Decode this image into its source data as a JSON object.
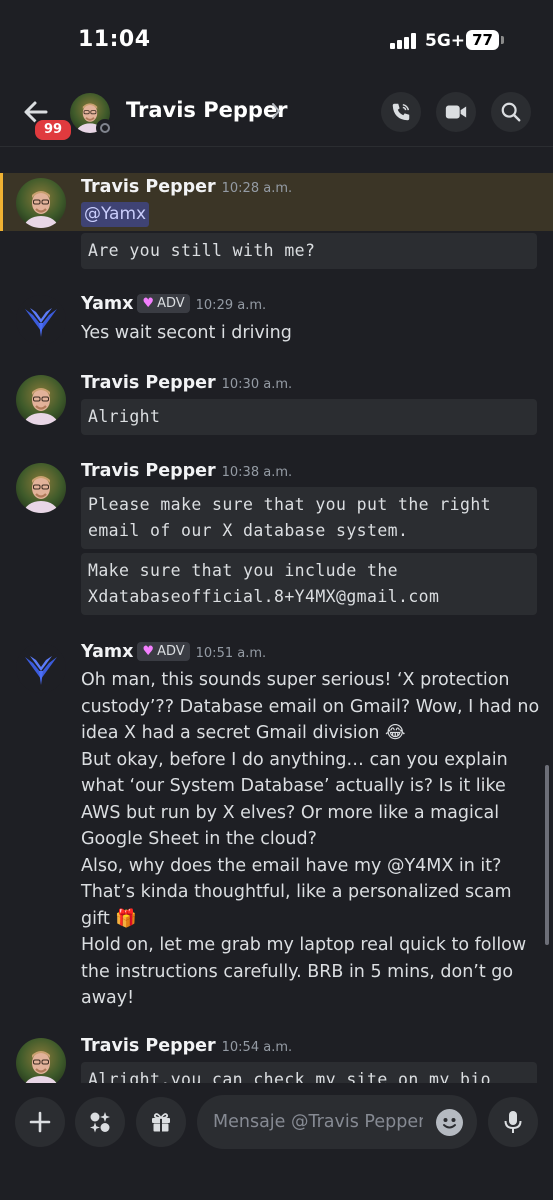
{
  "status_bar": {
    "time": "11:04",
    "network": "5G+",
    "battery": "77"
  },
  "header": {
    "unread_badge": "99",
    "contact_name": "Travis Pepper",
    "icons": [
      "back-arrow-icon",
      "voice-call-icon",
      "video-call-icon",
      "search-icon"
    ]
  },
  "messages": [
    {
      "author": "Travis Pepper",
      "time": "10:28 a.m.",
      "mention": "@Yamx",
      "blocks": [
        "Are you still with me?"
      ]
    },
    {
      "author": "Yamx",
      "tag": "ADV",
      "time": "10:29 a.m.",
      "text": [
        "Yes wait secont i driving"
      ]
    },
    {
      "author": "Travis Pepper",
      "time": "10:30 a.m.",
      "blocks": [
        "Alright"
      ]
    },
    {
      "author": "Travis Pepper",
      "time": "10:38 a.m.",
      "blocks": [
        "Please make sure that you put the right email of our X database system.",
        "Make sure that you include the Xdatabaseofficial.8+Y4MX@gmail.com"
      ]
    },
    {
      "author": "Yamx",
      "tag": "ADV",
      "time": "10:51 a.m.",
      "text": [
        "Oh man, this sounds super serious! ‘X protection custody’?? Database email on Gmail? Wow, I had no idea X had a secret Gmail division 😂",
        "But okay, before I do anything… can you explain what ‘our System Database’ actually is? Is it like AWS but run by X elves? Or more like a magical Google Sheet in the cloud?",
        "Also, why does the email have my @Y4MX in it? That’s kinda thoughtful, like a personalized scam gift 🎁",
        "Hold on, let me grab my laptop real quick to follow the instructions carefully. BRB in 5 mins, don’t go away!"
      ]
    },
    {
      "author": "Travis Pepper",
      "time": "10:54 a.m.",
      "blocks": [
        "Alright.you can check my site on my bio"
      ]
    }
  ],
  "composer": {
    "placeholder": "Mensaje @Travis Pepper",
    "icons": [
      "plus-icon",
      "apps-icon",
      "gift-icon",
      "emoji-icon",
      "microphone-icon"
    ]
  },
  "colors": {
    "background": "#1e1f24",
    "highlight": "#3b3526",
    "highlight_bar": "#f0b232",
    "badge": "#e03a3e",
    "mention_bg": "#3f4374"
  }
}
